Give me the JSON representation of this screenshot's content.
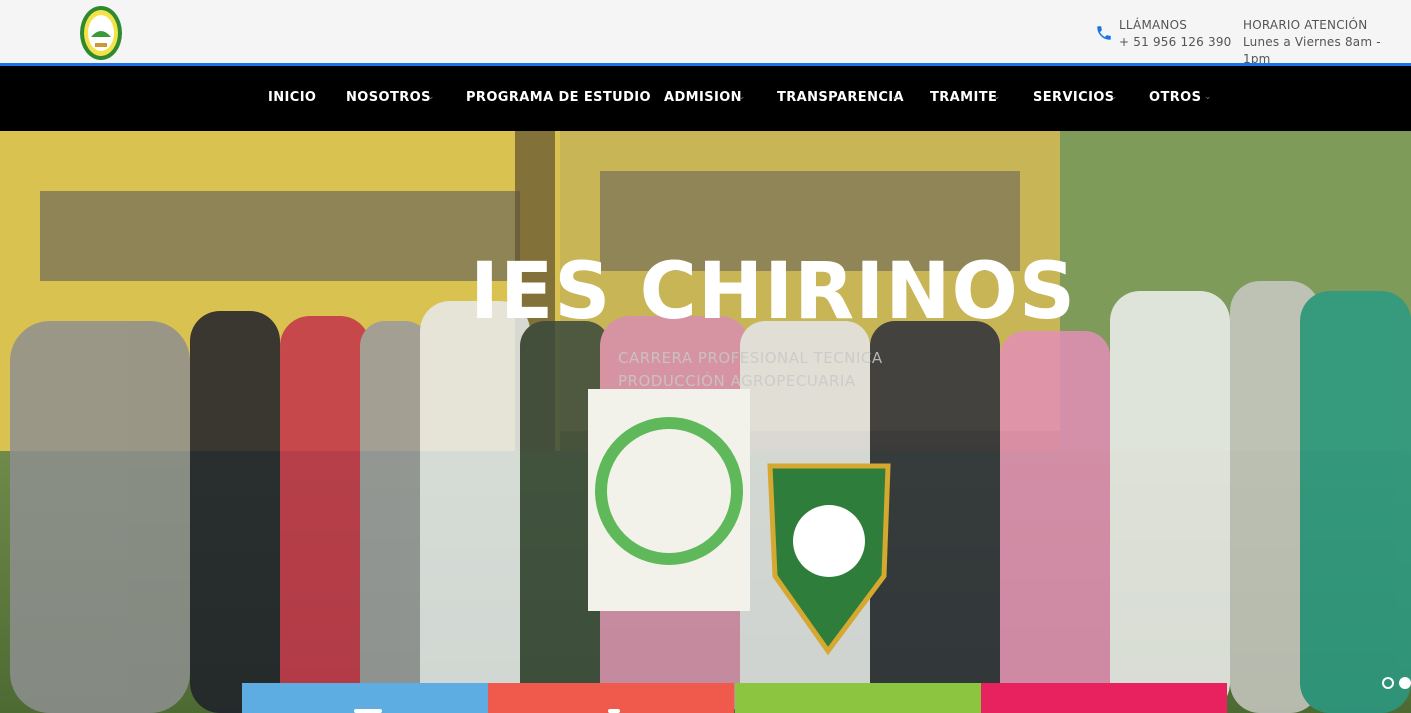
{
  "header": {
    "logo_icon": "institution-seal-icon",
    "call_label": "LLÁMANOS",
    "call_value": "+ 51 956 126 390",
    "hours_label": "HORARIO ATENCIÓN",
    "hours_value": "Lunes a Viernes 8am - 1pm",
    "phone_icon": "phone-icon",
    "accent_color": "#1a73e8"
  },
  "nav": {
    "items": [
      {
        "label": "INICIO",
        "has_dropdown": false
      },
      {
        "label": "NOSOTROS",
        "has_dropdown": true
      },
      {
        "label": "PROGRAMA DE ESTUDIO",
        "has_dropdown": true
      },
      {
        "label": "ADMISION",
        "has_dropdown": true
      },
      {
        "label": "TRANSPARENCIA",
        "has_dropdown": true
      },
      {
        "label": "TRAMITE",
        "has_dropdown": true
      },
      {
        "label": "SERVICIOS",
        "has_dropdown": true
      },
      {
        "label": "OTROS",
        "has_dropdown": true
      }
    ],
    "caret_icon": "chevron-down-icon"
  },
  "hero": {
    "title": "IES CHIRINOS",
    "subtitle_line1": "CARRERA PROFESIONAL TECNICA",
    "subtitle_line2": "PRODUCCIÓN AGROPECUARIA",
    "image": "group-photo-students-with-banners",
    "slider_dots": 2,
    "active_dot": 1
  },
  "tiles": [
    {
      "color": "#5dade2"
    },
    {
      "color": "#ef5a4c"
    },
    {
      "color": "#8cc540"
    },
    {
      "color": "#e8215f"
    }
  ]
}
